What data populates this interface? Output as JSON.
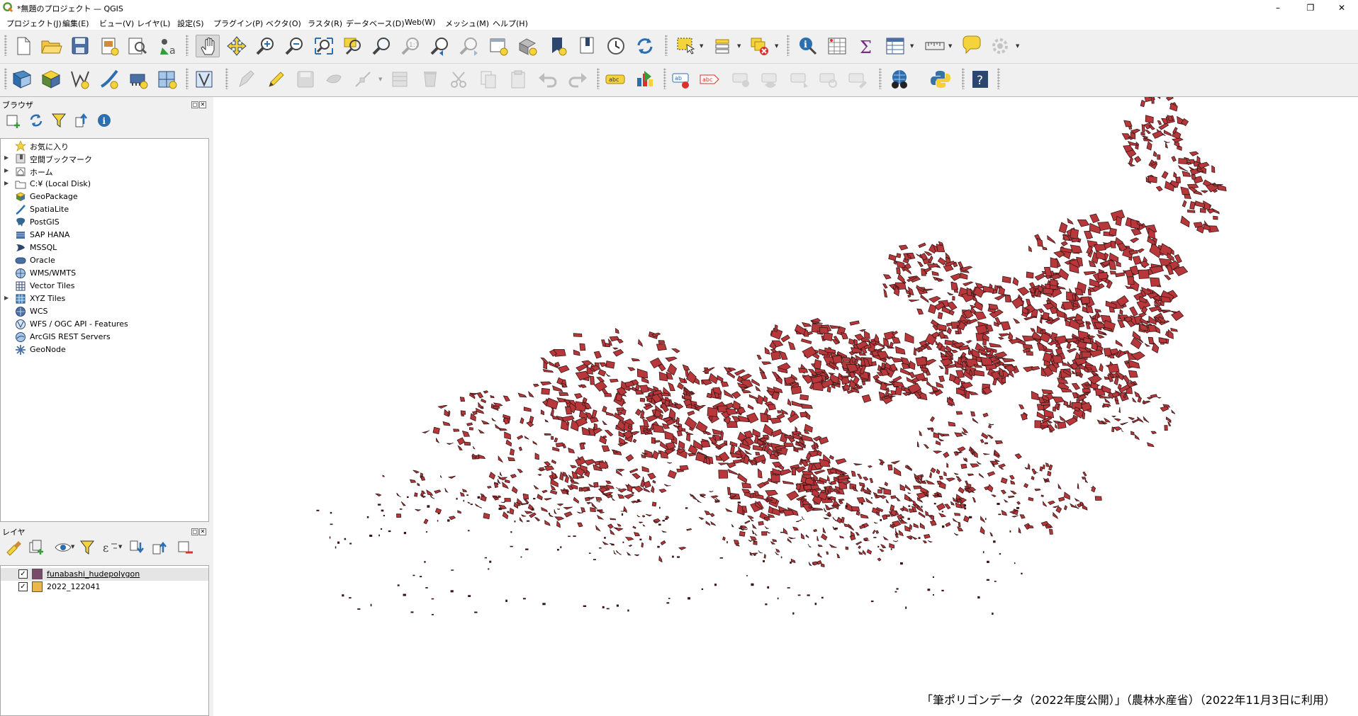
{
  "window": {
    "title": "*無題のプロジェクト — QGIS",
    "buttons": {
      "minimize": "–",
      "restore": "❐",
      "close": "✕"
    }
  },
  "menu": [
    "プロジェクト(J)",
    "編集(E)",
    "ビュー(V)",
    "レイヤ(L)",
    "設定(S)",
    "プラグイン(P)",
    "ベクタ(O)",
    "ラスタ(R)",
    "データベース(D)",
    "Web(W)",
    "メッシュ(M)",
    "ヘルプ(H)"
  ],
  "browser_panel": {
    "title": "ブラウザ",
    "items": [
      {
        "label": "お気に入り",
        "icon": "star-icon",
        "expandable": false
      },
      {
        "label": "空間ブックマーク",
        "icon": "bookmark-icon",
        "expandable": true
      },
      {
        "label": "ホーム",
        "icon": "home-icon",
        "expandable": true
      },
      {
        "label": "C:¥ (Local Disk)",
        "icon": "folder-icon",
        "expandable": true
      },
      {
        "label": "GeoPackage",
        "icon": "geopackage-icon",
        "expandable": false
      },
      {
        "label": "SpatiaLite",
        "icon": "spatialite-icon",
        "expandable": false
      },
      {
        "label": "PostGIS",
        "icon": "postgis-icon",
        "expandable": false
      },
      {
        "label": "SAP HANA",
        "icon": "sap-hana-icon",
        "expandable": false
      },
      {
        "label": "MSSQL",
        "icon": "mssql-icon",
        "expandable": false
      },
      {
        "label": "Oracle",
        "icon": "oracle-icon",
        "expandable": false
      },
      {
        "label": "WMS/WMTS",
        "icon": "wms-icon",
        "expandable": false
      },
      {
        "label": "Vector Tiles",
        "icon": "vector-tiles-icon",
        "expandable": false
      },
      {
        "label": "XYZ Tiles",
        "icon": "xyz-tiles-icon",
        "expandable": true
      },
      {
        "label": "WCS",
        "icon": "wcs-icon",
        "expandable": false
      },
      {
        "label": "WFS / OGC API - Features",
        "icon": "wfs-icon",
        "expandable": false
      },
      {
        "label": "ArcGIS REST Servers",
        "icon": "arcgis-icon",
        "expandable": false
      },
      {
        "label": "GeoNode",
        "icon": "geonode-icon",
        "expandable": false
      }
    ]
  },
  "layers_panel": {
    "title": "レイヤ",
    "layers": [
      {
        "name": "funabashi_hudepolygon",
        "checked": true,
        "color": "#7b4a6a",
        "checkmark": "✓"
      },
      {
        "name": "2022_122041",
        "checked": true,
        "color": "#e8b84a",
        "checkmark": "✓"
      }
    ]
  },
  "map": {
    "attribution": "「筆ポリゴンデータ（2022年度公開）」（農林水産省）（2022年11月3日に利用）",
    "parcel_fill": "#b8373a",
    "parcel_stroke": "#3a1616",
    "background": "#ffffff"
  },
  "dock_buttons": {
    "float": "◻",
    "close": "✕"
  }
}
